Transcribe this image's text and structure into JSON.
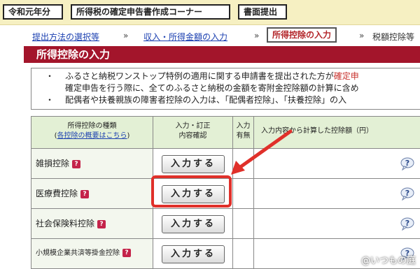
{
  "toolbar": {
    "era": "令和元年分",
    "corner": "所得税の確定申告書作成コーナー",
    "submit": "書面提出"
  },
  "breadcrumb": {
    "items": [
      "提出方法の選択等",
      "収入・所得金額の入力",
      "所得控除の入力",
      "税額控除等"
    ],
    "separator": "»"
  },
  "title": "所得控除の入力",
  "notice": {
    "bullet": "・",
    "line1_a": "ふるさと納税ワンストップ特例の適用に関する申請書を提出された方が",
    "line1_b": "確定申",
    "line2": "確定申告を行う際に、全てのふるさと納税の金額を寄附金控除額の計算に含め",
    "line3": "配偶者や扶養親族の障害者控除の入力は、「配偶者控除」、「扶養控除」の入"
  },
  "table": {
    "header": {
      "type_line1": "所得控除の種類",
      "type_open": "(",
      "type_link": "各控除の概要はこちら",
      "type_close": ")",
      "input_line1": "入力・訂正",
      "input_line2": "内容確認",
      "flag_line1": "入力",
      "flag_line2": "有無",
      "amount": "入力内容から計算した控除額（円）"
    },
    "button_label": "入力する",
    "rows": [
      {
        "name": "雑損控除"
      },
      {
        "name": "医療費控除"
      },
      {
        "name": "社会保険料控除"
      },
      {
        "name": "小規模企業共済等掛金控除"
      }
    ],
    "qmark": "?"
  },
  "colors": {
    "title_bg": "#a3152b",
    "highlight": "#e0302a",
    "header_bg": "#e3f0d5"
  },
  "watermark": "@いつもの庭"
}
